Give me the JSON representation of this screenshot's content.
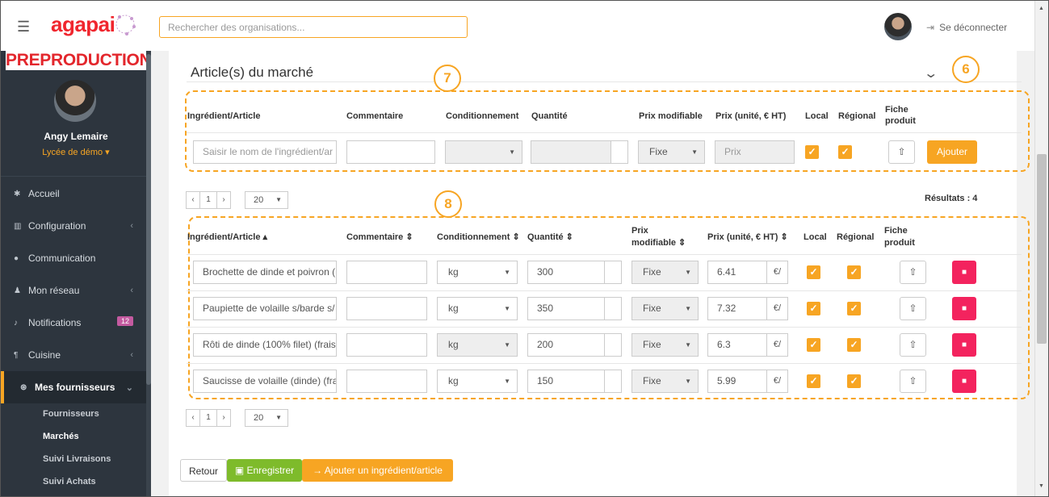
{
  "topbar": {
    "logo": "agapai",
    "search_placeholder": "Rechercher des organisations...",
    "logout_label": "Se déconnecter"
  },
  "sidebar": {
    "env_banner": "PREPRODUCTION",
    "user_name": "Angy Lemaire",
    "school": "Lycée de démo ▾",
    "items": [
      {
        "label": "Accueil",
        "icon": "home-icon"
      },
      {
        "label": "Configuration",
        "icon": "bank-icon"
      },
      {
        "label": "Communication",
        "icon": "chat-icon"
      },
      {
        "label": "Mon réseau",
        "icon": "users-icon"
      },
      {
        "label": "Notifications",
        "icon": "bell-icon",
        "badge": "12"
      },
      {
        "label": "Cuisine",
        "icon": "cutlery-icon"
      },
      {
        "label": "Mes fournisseurs",
        "icon": "handshake-icon"
      }
    ],
    "subitems": [
      "Fournisseurs",
      "Marchés",
      "Suivi Livraisons",
      "Suivi Achats"
    ]
  },
  "panel": {
    "title": "Article(s) du marché",
    "callouts": [
      "7",
      "6",
      "8"
    ]
  },
  "add_form": {
    "headers": {
      "ingredient": "Ingrédient/Article",
      "comment": "Commentaire",
      "packaging": "Conditionnement",
      "quantity": "Quantité",
      "price_mod": "Prix modifiable",
      "price": "Prix (unité, € HT)",
      "local": "Local",
      "regional": "Régional",
      "sheet": "Fiche produit"
    },
    "ingredient_placeholder": "Saisir le nom de l'ingrédient/ar",
    "price_mod_value": "Fixe",
    "price_placeholder": "Prix",
    "add_button": "Ajouter"
  },
  "pagination": {
    "prev": "‹",
    "page": "1",
    "next": "›",
    "page_size": "20",
    "results": "Résultats : 4"
  },
  "table": {
    "headers": {
      "ingredient": "Ingrédient/Article ▴",
      "comment": "Commentaire ⇕",
      "packaging": "Conditionnement ⇕",
      "quantity": "Quantité ⇕",
      "price_mod_1": "Prix",
      "price_mod_2": "modifiable ⇕",
      "price": "Prix (unité, € HT) ⇕",
      "local": "Local",
      "regional": "Régional",
      "sheet_1": "Fiche",
      "sheet_2": "produit"
    },
    "rows": [
      {
        "ingredient": "Brochette de dinde et poivron (",
        "packaging": "kg",
        "quantity": "300",
        "price_mod": "Fixe",
        "price": "6.41",
        "unit": "€/"
      },
      {
        "ingredient": "Paupiette de volaille s/barde s/",
        "packaging": "kg",
        "quantity": "350",
        "price_mod": "Fixe",
        "price": "7.32",
        "unit": "€/"
      },
      {
        "ingredient": "Rôti de dinde (100% filet) (frais)",
        "packaging": "kg",
        "quantity": "200",
        "price_mod": "Fixe",
        "price": "6.3",
        "unit": "€/"
      },
      {
        "ingredient": "Saucisse de volaille (dinde) (fra",
        "packaging": "kg",
        "quantity": "150",
        "price_mod": "Fixe",
        "price": "5.99",
        "unit": "€/"
      }
    ]
  },
  "footer": {
    "back": "Retour",
    "save": "Enregistrer",
    "add_item": "→ Ajouter un ingrédient/article"
  },
  "colors": {
    "accent": "#f7a523",
    "danger": "#f3235e",
    "success": "#7ebb2b",
    "sidebar": "#2d353e"
  }
}
